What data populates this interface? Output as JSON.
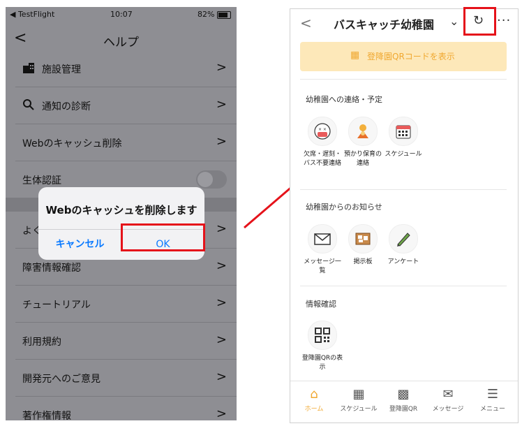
{
  "left_screen": {
    "status": {
      "carrier": "◀ TestFlight",
      "time": "10:07",
      "battery": "82%"
    },
    "nav": {
      "back": "<",
      "title": "ヘルプ"
    },
    "items": [
      {
        "label": "施設管理"
      },
      {
        "label": "通知の診断"
      },
      {
        "label": "Webのキャッシュ削除"
      },
      {
        "label": "生体認証"
      },
      {
        "label": "よく"
      },
      {
        "label": "障害情報確認"
      },
      {
        "label": "チュートリアル"
      },
      {
        "label": "利用規約"
      },
      {
        "label": "開発元へのご意見"
      },
      {
        "label": "著作権情報"
      }
    ],
    "dialog": {
      "message": "Webのキャッシュを削除します",
      "cancel": "キャンセル",
      "ok": "OK"
    }
  },
  "right_screen": {
    "header": {
      "back": "<",
      "title": "バスキャッチ幼稚園",
      "more": "···"
    },
    "qr_banner": {
      "text": "登降園QRコードを表示"
    },
    "sections": [
      {
        "title": "幼稚園への連絡・予定",
        "tiles": [
          {
            "icon": "mask-face-icon",
            "label": "欠席・遅刻・バス不要連絡"
          },
          {
            "icon": "childcare-icon",
            "label": "預かり保育の連絡"
          },
          {
            "icon": "calendar-icon",
            "label": "スケジュール"
          }
        ]
      },
      {
        "title": "幼稚園からのお知らせ",
        "tiles": [
          {
            "icon": "envelope-icon",
            "label": "メッセージ一覧"
          },
          {
            "icon": "board-icon",
            "label": "掲示板"
          },
          {
            "icon": "pen-icon",
            "label": "アンケート"
          }
        ]
      },
      {
        "title": "情報確認",
        "tiles": [
          {
            "icon": "qr-icon",
            "label": "登降園QRの表示"
          }
        ]
      }
    ],
    "tabbar": [
      {
        "icon": "home-icon",
        "label": "ホーム",
        "active": true
      },
      {
        "icon": "calendar-icon",
        "label": "スケジュール"
      },
      {
        "icon": "qr-icon",
        "label": "登降園QR"
      },
      {
        "icon": "envelope-icon",
        "label": "メッセージ"
      },
      {
        "icon": "menu-icon",
        "label": "メニュー"
      }
    ]
  },
  "colors": {
    "highlight": "#e5121a",
    "accent": "#f0a830",
    "ios_blue": "#0a7aff"
  }
}
